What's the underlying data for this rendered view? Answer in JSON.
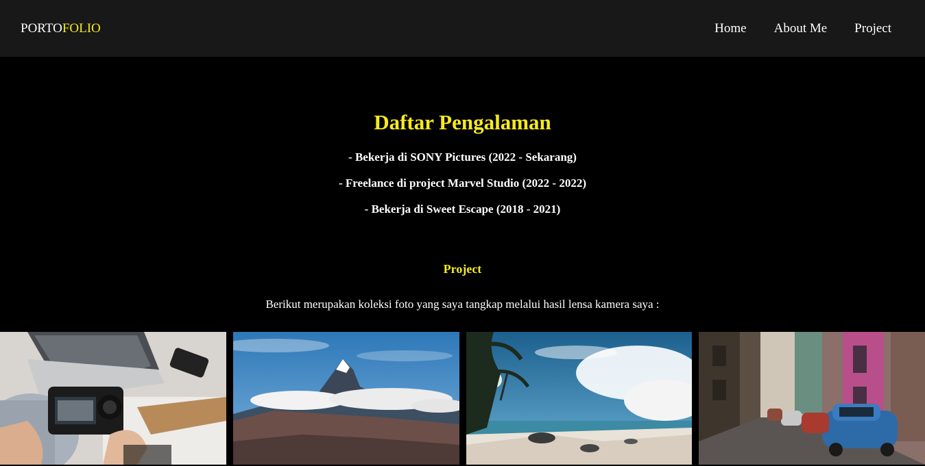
{
  "navbar": {
    "brand_part1": "PORTO",
    "brand_part2": "FOLIO",
    "links": [
      "Home",
      "About Me",
      "Project"
    ]
  },
  "experience": {
    "title": "Daftar Pengalaman",
    "items": [
      "- Bekerja di SONY Pictures (2022 - Sekarang)",
      "- Freelance di project Marvel Studio (2022 - 2022)",
      "- Bekerja di Sweet Escape (2018 - 2021)"
    ]
  },
  "project": {
    "title": "Project",
    "description": "Berikut merupakan koleksi foto yang saya tangkap melalui hasil lensa kamera saya :"
  },
  "colors": {
    "accent": "#f5ea1e",
    "navbar_bg": "#181818",
    "page_bg": "#000000"
  }
}
